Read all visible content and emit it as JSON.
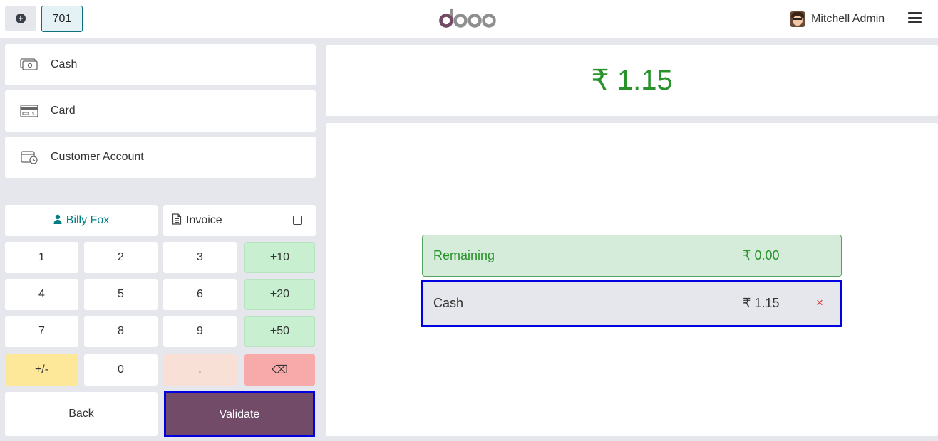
{
  "header": {
    "new_order_icon": "plus-circle-icon",
    "order_tab": "701",
    "logo_text": "odoo",
    "user_name": "Mitchell Admin",
    "menu_icon": "hamburger-menu-icon"
  },
  "payment_methods": [
    {
      "label": "Cash",
      "icon": "cash-icon"
    },
    {
      "label": "Card",
      "icon": "card-icon"
    },
    {
      "label": "Customer Account",
      "icon": "wallet-clock-icon"
    }
  ],
  "customer": {
    "name": "Billy Fox",
    "icon": "person-icon"
  },
  "invoice": {
    "label": "Invoice",
    "checked": false
  },
  "numpad": {
    "k1": "1",
    "k2": "2",
    "k3": "3",
    "p10": "+10",
    "k4": "4",
    "k5": "5",
    "k6": "6",
    "p20": "+20",
    "k7": "7",
    "k8": "8",
    "k9": "9",
    "p50": "+50",
    "sign": "+/-",
    "k0": "0",
    "dot": ".",
    "backspace": "⌫"
  },
  "actions": {
    "back": "Back",
    "validate": "Validate"
  },
  "summary": {
    "total": "₹ 1.15",
    "remaining_label": "Remaining",
    "remaining_value": "₹ 0.00"
  },
  "payment_lines": [
    {
      "method": "Cash",
      "amount": "₹ 1.15",
      "remove": "×"
    }
  ],
  "colors": {
    "brand": "#714b67",
    "accent": "#017e84",
    "success": "#28922b",
    "selection": "#0000e0"
  }
}
